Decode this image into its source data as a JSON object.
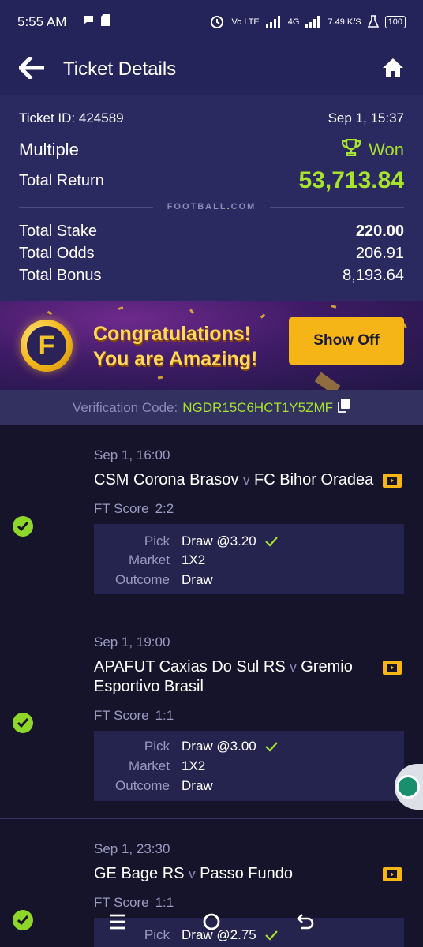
{
  "status_bar": {
    "time": "5:55 AM",
    "network": "Vo LTE",
    "speed": "7.49 K/S",
    "battery": "100",
    "signal_4g": "4G"
  },
  "app_bar": {
    "title": "Ticket Details",
    "back_icon": "back-arrow-icon",
    "home_icon": "home-icon"
  },
  "ticket": {
    "id_label": "Ticket ID: 424589",
    "date": "Sep 1, 15:37",
    "type": "Multiple",
    "result": "Won",
    "return_label": "Total Return",
    "return_value": "53,713.84",
    "brand": "FOOTBALL",
    "brand_suffix": "COM",
    "stake_label": "Total Stake",
    "stake_value": "220.00",
    "odds_label": "Total Odds",
    "odds_value": "206.91",
    "bonus_label": "Total Bonus",
    "bonus_value": "8,193.64"
  },
  "banner": {
    "line1": "Congratulations!",
    "line2": "You are Amazing!",
    "button": "Show Off",
    "coin_letter": "F"
  },
  "verification": {
    "label": "Verification Code:",
    "code": "NGDR15C6HCT1Y5ZMF"
  },
  "matches": [
    {
      "date": "Sep 1, 16:00",
      "home": "CSM Corona Brasov",
      "v": "v",
      "away": "FC Bihor Oradea",
      "score_label": "FT Score",
      "score": "2:2",
      "pick_label": "Pick",
      "pick": "Draw @3.20",
      "market_label": "Market",
      "market": "1X2",
      "outcome_label": "Outcome",
      "outcome": "Draw"
    },
    {
      "date": "Sep 1, 19:00",
      "home": "APAFUT Caxias Do Sul RS",
      "v": "v",
      "away": "Gremio Esportivo Brasil",
      "score_label": "FT Score",
      "score": "1:1",
      "pick_label": "Pick",
      "pick": "Draw @3.00",
      "market_label": "Market",
      "market": "1X2",
      "outcome_label": "Outcome",
      "outcome": "Draw"
    },
    {
      "date": "Sep 1, 23:30",
      "home": "GE Bage RS",
      "v": "v",
      "away": "Passo Fundo",
      "score_label": "FT Score",
      "score": "1:1",
      "pick_label": "Pick",
      "pick": "Draw @2.75"
    }
  ],
  "colors": {
    "accent_green": "#a7e22f",
    "header_bg": "#25245a",
    "gold": "#f5b517"
  }
}
